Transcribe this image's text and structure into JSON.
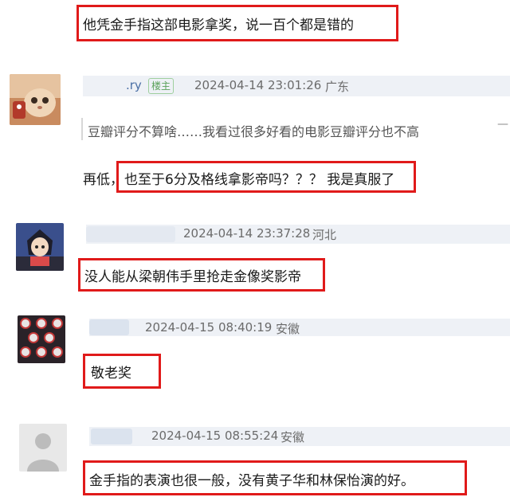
{
  "comments": [
    {
      "text": "他凭金手指这部电影拿奖，说一百个都是错的"
    },
    {
      "username": ".ry",
      "badge": "楼主",
      "timestamp": "2024-04-14 23:01:26",
      "location": "广东",
      "quote": "豆瓣评分不算啥……我看过很多好看的电影豆瓣评分也不高",
      "text_prefix": "再低，",
      "text_highlight": "也至于6分及格线拿影帝吗？？？ 我是真服了"
    },
    {
      "timestamp": "2024-04-14 23:37:28",
      "location": "河北",
      "text": "没人能从梁朝伟手里抢走金像奖影帝"
    },
    {
      "timestamp": "2024-04-15 08:40:19",
      "location": "安徽",
      "text": "敬老奖"
    },
    {
      "timestamp": "2024-04-15 08:55:24",
      "location": "安徽",
      "text": "金手指的表演也很一般，没有黄子华和林保怡演的好。"
    }
  ],
  "more_icon": "dash-icon",
  "colors": {
    "highlight_border": "#e01a1a",
    "meta_text": "#6b6b6b",
    "badge_green": "#5aa15a"
  }
}
